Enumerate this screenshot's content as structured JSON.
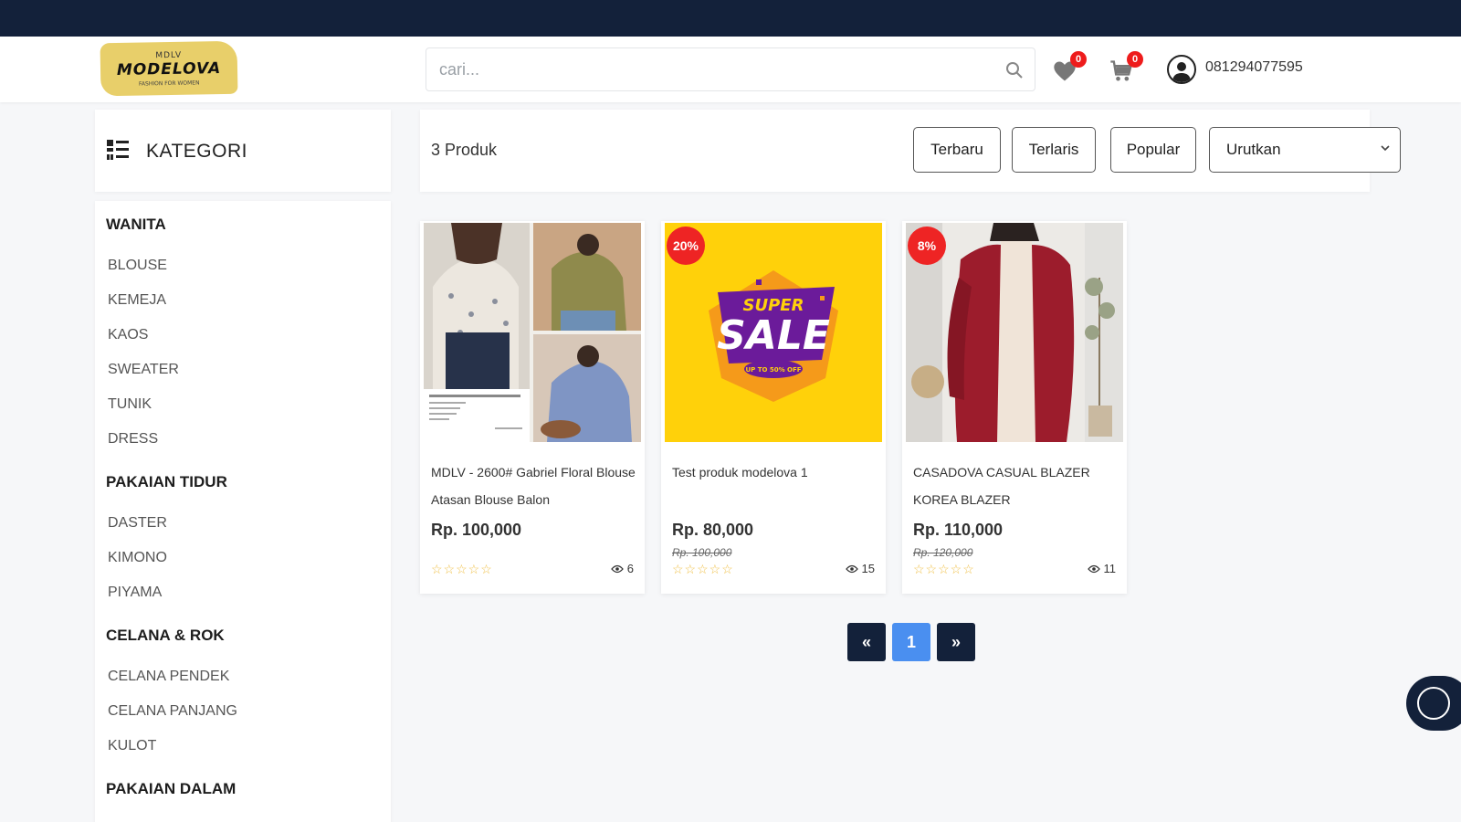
{
  "logo": {
    "line1": "MDLV",
    "line2": "MODELOVA",
    "line3": "FASHION FOR WOMEN"
  },
  "search": {
    "placeholder": "cari..."
  },
  "header": {
    "wishlist_count": "0",
    "cart_count": "0",
    "phone": "081294077595"
  },
  "sidebar": {
    "title": "KATEGORI",
    "groups": [
      {
        "name": "WANITA",
        "items": [
          "BLOUSE",
          "KEMEJA",
          "KAOS",
          "SWEATER",
          "TUNIK",
          "DRESS"
        ]
      },
      {
        "name": "PAKAIAN TIDUR",
        "items": [
          "DASTER",
          "KIMONO",
          "PIYAMA"
        ]
      },
      {
        "name": "CELANA & ROK",
        "items": [
          "CELANA PENDEK",
          "CELANA PANJANG",
          "KULOT"
        ]
      },
      {
        "name": "PAKAIAN DALAM",
        "items": []
      }
    ]
  },
  "toolbar": {
    "count": "3 Produk",
    "filters": [
      "Terbaru",
      "Terlaris",
      "Popular"
    ],
    "sort_selected": "Urutkan"
  },
  "products": [
    {
      "name": "MDLV - 2600# Gabriel Floral Blouse Atasan Blouse Balon",
      "price": "Rp. 100,000",
      "old_price": "",
      "discount": "",
      "stars": "☆☆☆☆☆",
      "views": "6"
    },
    {
      "name": "Test produk modelova 1",
      "price": "Rp. 80,000",
      "old_price": "Rp. 100,000",
      "discount": "20%",
      "stars": "☆☆☆☆☆",
      "views": "15",
      "image_text": {
        "top": "SUPER",
        "main": "SALE",
        "sub": "UP TO 50% OFF"
      }
    },
    {
      "name": "CASADOVA CASUAL BLAZER KOREA BLAZER",
      "price": "Rp. 110,000",
      "old_price": "Rp. 120,000",
      "discount": "8%",
      "stars": "☆☆☆☆☆",
      "views": "11"
    }
  ],
  "pagination": {
    "prev": "«",
    "current": "1",
    "next": "»"
  },
  "colors": {
    "navy": "#13213a",
    "accent_blue": "#4a8ff0",
    "badge_red": "#ee1c1c",
    "logo_yellow": "#e8cf6a",
    "sale_yellow": "#ffd10a",
    "blazer_red": "#9c1c2c"
  }
}
